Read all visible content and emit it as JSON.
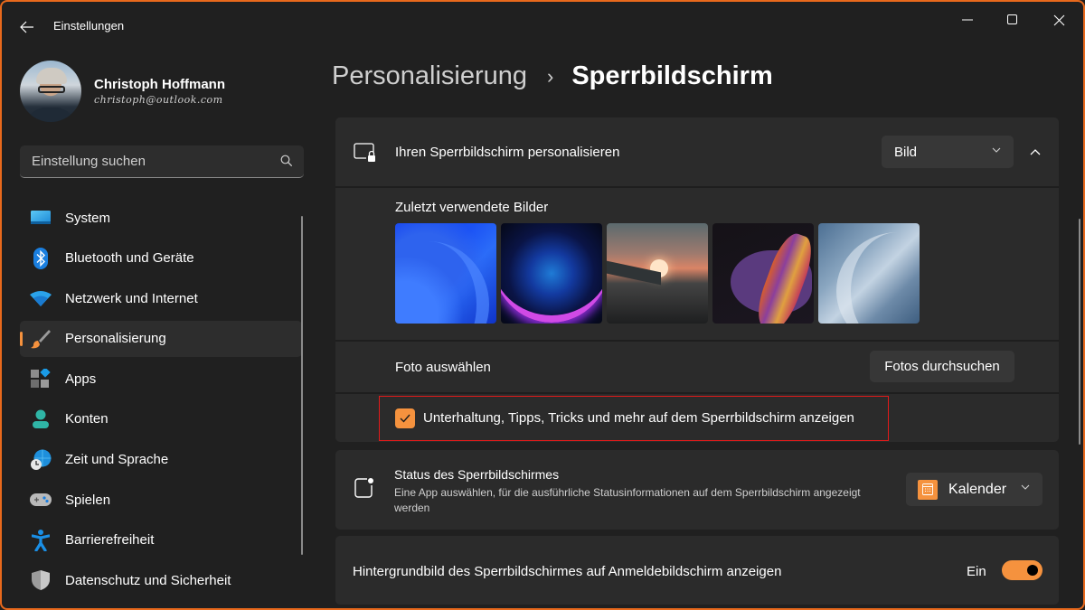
{
  "window": {
    "title": "Einstellungen",
    "accent_color": "#f5923e",
    "frame_color": "#e8691c"
  },
  "profile": {
    "name": "Christoph Hoffmann",
    "email": "christoph@outlook.com"
  },
  "search": {
    "placeholder": "Einstellung suchen"
  },
  "sidebar": {
    "items": [
      {
        "label": "System",
        "icon": "monitor-icon",
        "active": false
      },
      {
        "label": "Bluetooth und Geräte",
        "icon": "bluetooth-icon",
        "active": false
      },
      {
        "label": "Netzwerk und Internet",
        "icon": "wifi-icon",
        "active": false
      },
      {
        "label": "Personalisierung",
        "icon": "paintbrush-icon",
        "active": true
      },
      {
        "label": "Apps",
        "icon": "apps-icon",
        "active": false
      },
      {
        "label": "Konten",
        "icon": "account-icon",
        "active": false
      },
      {
        "label": "Zeit und Sprache",
        "icon": "globe-clock-icon",
        "active": false
      },
      {
        "label": "Spielen",
        "icon": "gamepad-icon",
        "active": false
      },
      {
        "label": "Barrierefreiheit",
        "icon": "accessibility-icon",
        "active": false
      },
      {
        "label": "Datenschutz und Sicherheit",
        "icon": "shield-icon",
        "active": false
      }
    ]
  },
  "breadcrumb": {
    "parent": "Personalisierung",
    "separator": "›",
    "current": "Sperrbildschirm"
  },
  "lockscreen": {
    "title": "Ihren Sperrbildschirm personalisieren",
    "mode_value": "Bild",
    "recent_label": "Zuletzt verwendete Bilder",
    "recent_images": [
      "Blaue Blüte",
      "Leuchtende Kugel",
      "Sonnenuntergang am See",
      "Farbige Welle",
      "Hellblaue Blüte"
    ],
    "photo_label": "Foto auswählen",
    "browse_button": "Fotos durchsuchen",
    "tips_checkbox_label": "Unterhaltung, Tipps, Tricks und mehr auf dem Sperrbildschirm anzeigen",
    "tips_checked": true
  },
  "status": {
    "title": "Status des Sperrbildschirmes",
    "description": "Eine App auswählen, für die ausführliche Statusinformationen auf dem Sperrbildschirm angezeigt werden",
    "app_value": "Kalender"
  },
  "signin_background": {
    "label": "Hintergrundbild des Sperrbildschirmes auf Anmeldebildschirm anzeigen",
    "state_label": "Ein",
    "enabled": true
  }
}
